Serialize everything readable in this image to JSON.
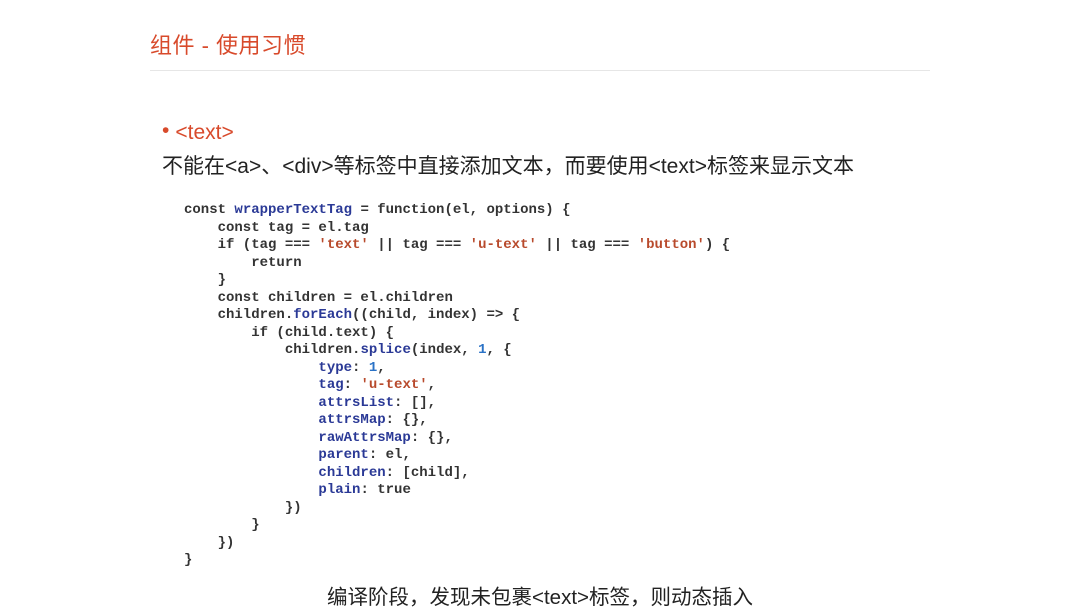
{
  "title": "组件 - 使用习惯",
  "bullet_tag": "<text>",
  "desc": "不能在<a>、<div>等标签中直接添加文本，而要使用<text>标签来显示文本",
  "code": {
    "l1a": "const ",
    "l1b": "wrapperTextTag",
    "l1c": " = function(el, options) {",
    "l2": "    const tag = el.tag",
    "l3a": "    if (tag === ",
    "l3s1": "'text'",
    "l3b": " || tag === ",
    "l3s2": "'u-text'",
    "l3c": " || tag === ",
    "l3s3": "'button'",
    "l3d": ") {",
    "l4": "        return",
    "l5": "    }",
    "l6": "    const children = el.children",
    "l7a": "    children.",
    "l7b": "forEach",
    "l7c": "((child, index) => {",
    "l8": "        if (child.text) {",
    "l9a": "            children.",
    "l9b": "splice",
    "l9c": "(index, ",
    "l9n": "1",
    "l9d": ", {",
    "l10a": "                ",
    "l10p": "type",
    "l10b": ": ",
    "l10n": "1",
    "l10c": ",",
    "l11a": "                ",
    "l11p": "tag",
    "l11b": ": ",
    "l11s": "'u-text'",
    "l11c": ",",
    "l12a": "                ",
    "l12p": "attrsList",
    "l12b": ": [],",
    "l13a": "                ",
    "l13p": "attrsMap",
    "l13b": ": {},",
    "l14a": "                ",
    "l14p": "rawAttrsMap",
    "l14b": ": {},",
    "l15a": "                ",
    "l15p": "parent",
    "l15b": ": el,",
    "l16a": "                ",
    "l16p": "children",
    "l16b": ": [child],",
    "l17a": "                ",
    "l17p": "plain",
    "l17b": ": true",
    "l18": "            })",
    "l19": "        }",
    "l20": "    })",
    "l21": "}"
  },
  "caption": "编译阶段，发现未包裹<text>标签，则动态插入"
}
